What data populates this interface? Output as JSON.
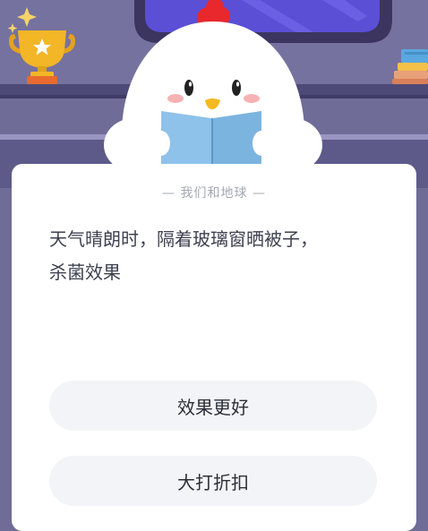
{
  "quiz": {
    "category": "— 我们和地球 —",
    "question_line1": "天气晴朗时，隔着玻璃窗晒被子，",
    "question_line2": "杀菌效果",
    "options": [
      "效果更好",
      "大打折扣"
    ]
  },
  "colors": {
    "wall": "#6f6c98",
    "shelf": "#4d4a78",
    "card": "#ffffff",
    "option_bg": "#f2f4f7",
    "text": "#3d4150",
    "muted": "#a3a8b3",
    "comb": "#e8282d",
    "book": "#8ec2ea",
    "trophy": "#f2b627"
  }
}
